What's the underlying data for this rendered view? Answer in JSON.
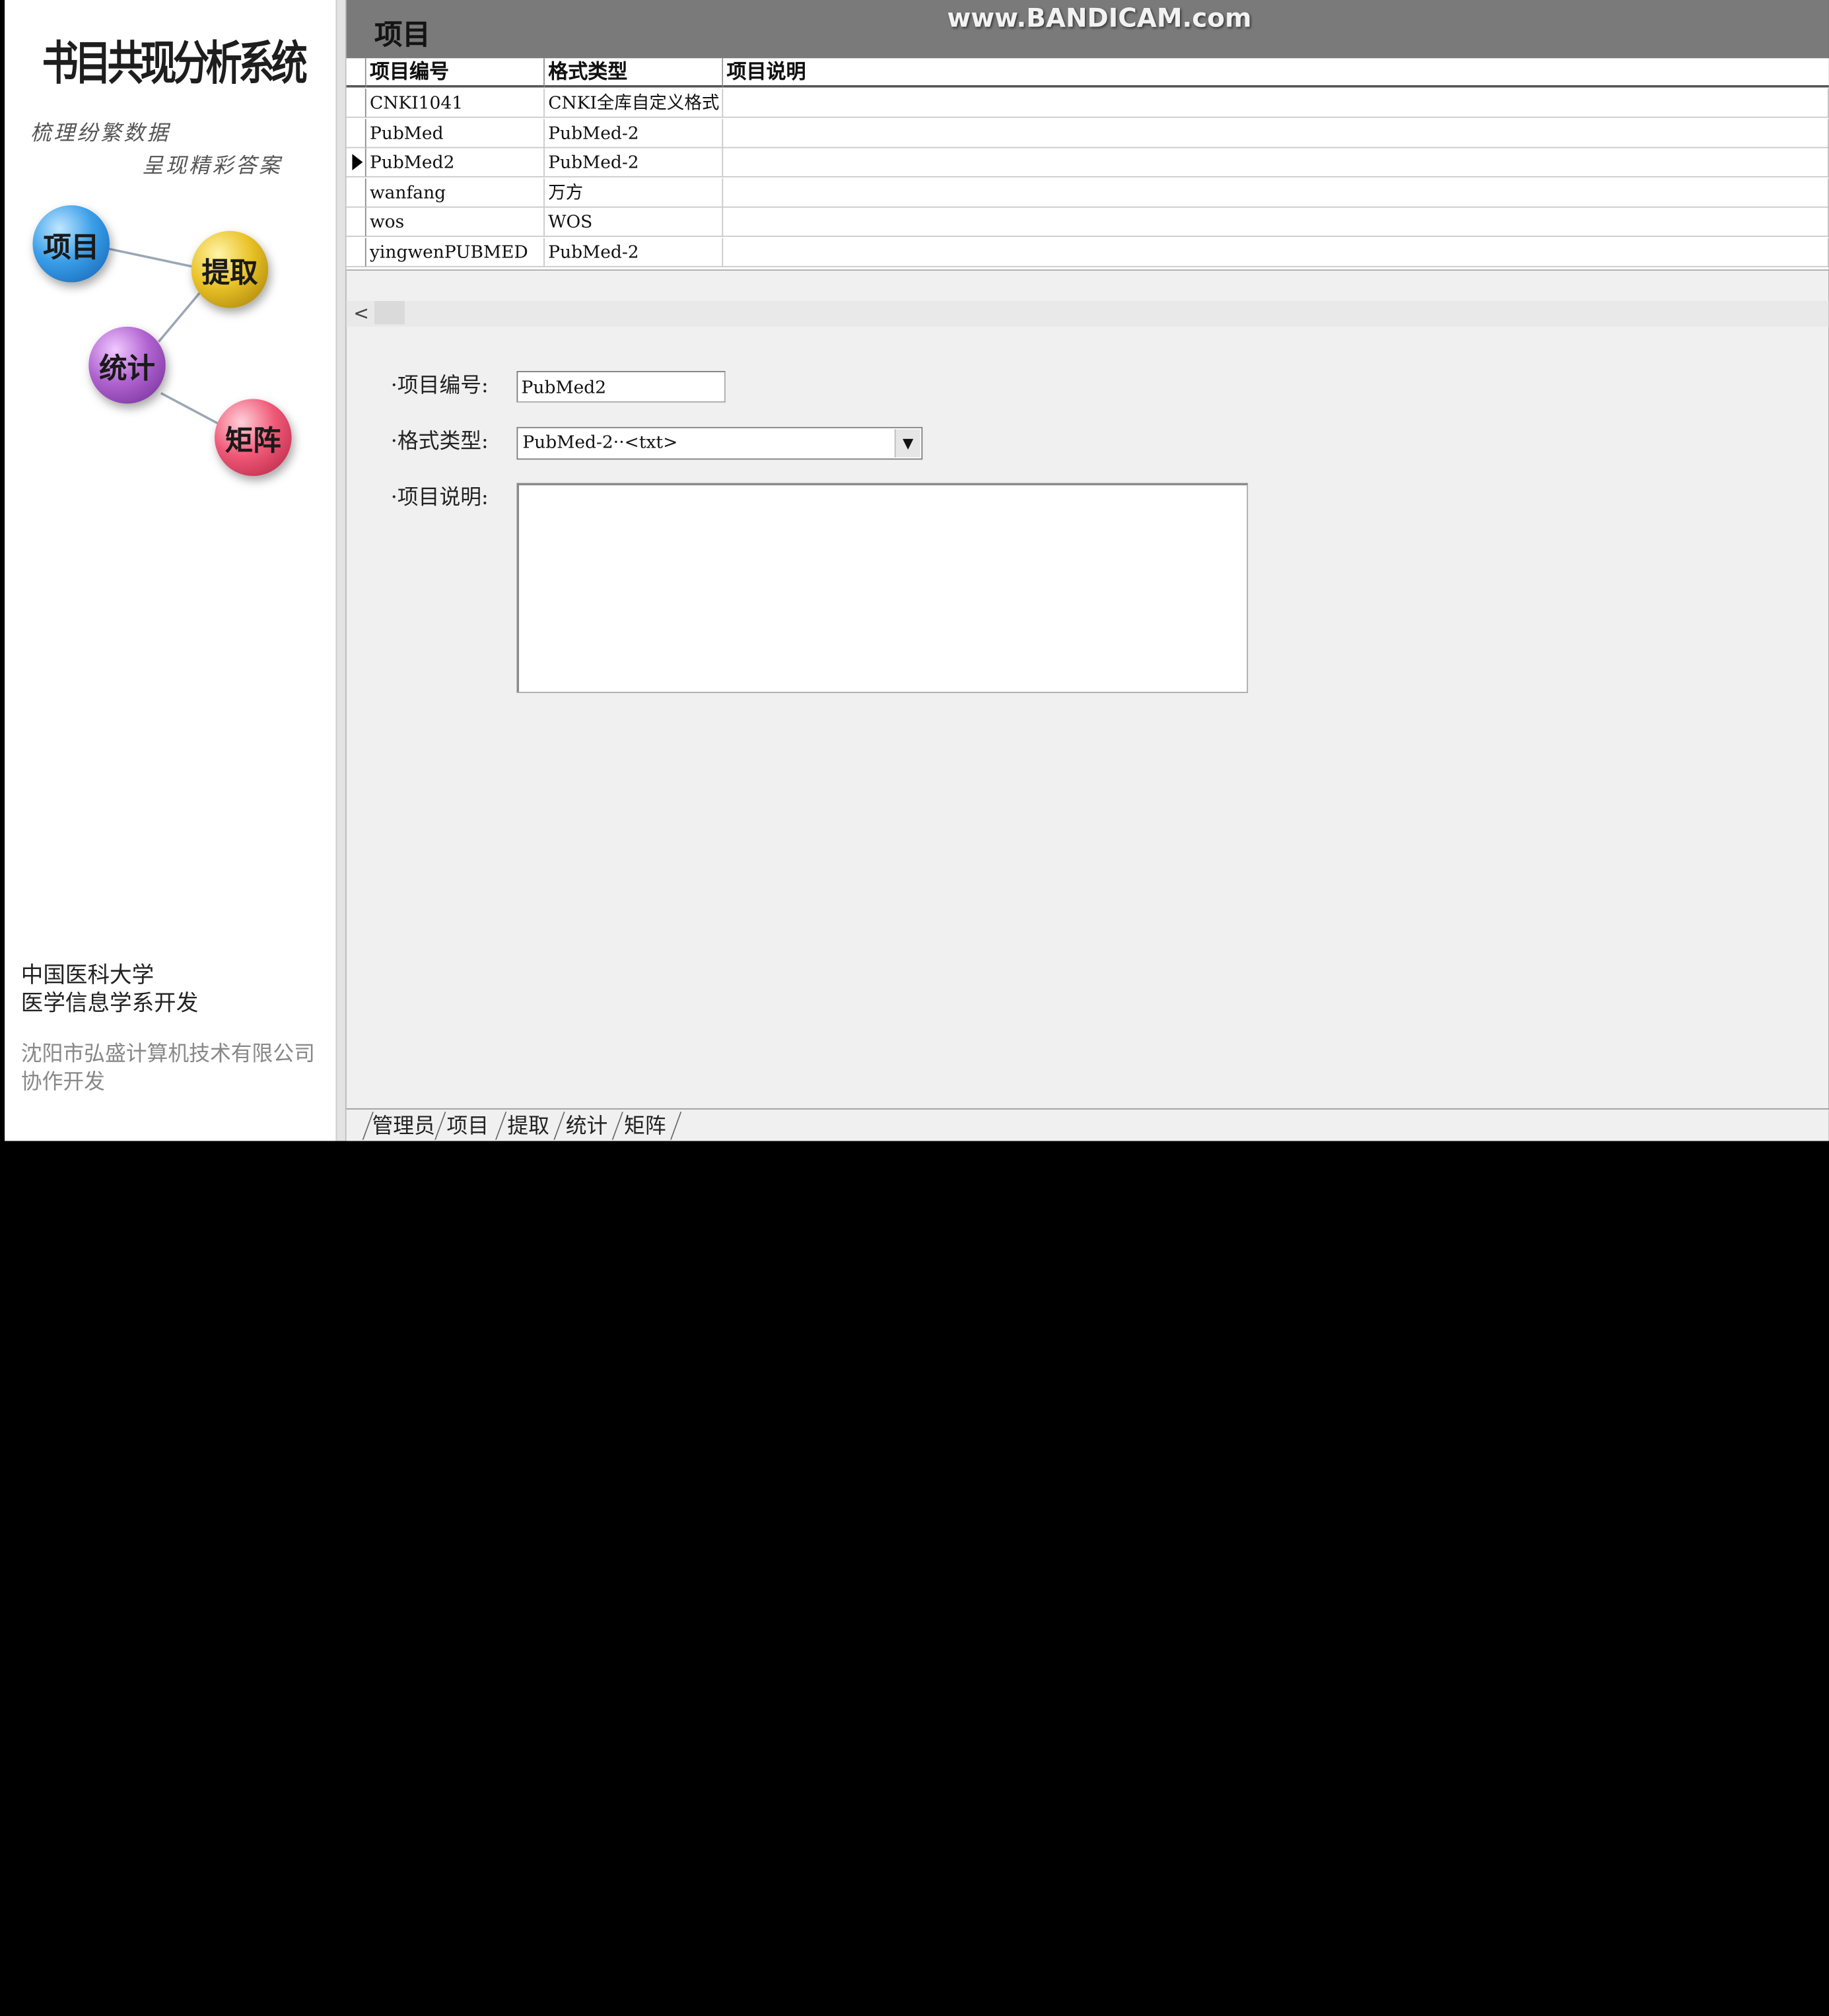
{
  "sidebar": {
    "title": "书目共现分析系统",
    "slogan_line1": "梳理纷繁数据",
    "slogan_line2": "呈现精彩答案",
    "nav": {
      "project": "项目",
      "extract": "提取",
      "statistics": "统计",
      "matrix": "矩阵"
    },
    "credit_line1": "中国医科大学",
    "credit_line2": "医学信息学系开发",
    "coop_line1": "沈阳市弘盛计算机技术有限公司",
    "coop_line2": "协作开发"
  },
  "header": {
    "title": "项目",
    "watermark": "www.BANDICAM.com"
  },
  "grid": {
    "columns": [
      "项目编号",
      "格式类型",
      "项目说明"
    ],
    "rows": [
      {
        "id": "CNKI1041",
        "format": "CNKI全库自定义格式",
        "desc": ""
      },
      {
        "id": "PubMed",
        "format": "PubMed-2",
        "desc": ""
      },
      {
        "id": "PubMed2",
        "format": "PubMed-2",
        "desc": ""
      },
      {
        "id": "wanfang",
        "format": "万方",
        "desc": ""
      },
      {
        "id": "wos",
        "format": "WOS",
        "desc": ""
      },
      {
        "id": "yingwenPUBMED",
        "format": "PubMed-2",
        "desc": ""
      }
    ],
    "selected_row": 2,
    "scroll_left_glyph": "<"
  },
  "form": {
    "id_label": "·项目编号:",
    "id_value": "PubMed2",
    "format_label": "·格式类型:",
    "format_value": "PubMed-2··<txt>",
    "desc_label": "·项目说明:",
    "desc_value": ""
  },
  "tabs": [
    "管理员",
    "项目",
    "提取",
    "统计",
    "矩阵"
  ],
  "colors": {
    "header_bg": "#7a7a7a",
    "panel_bg": "#f0f0f0",
    "sidebar_bg": "#ffffff"
  }
}
